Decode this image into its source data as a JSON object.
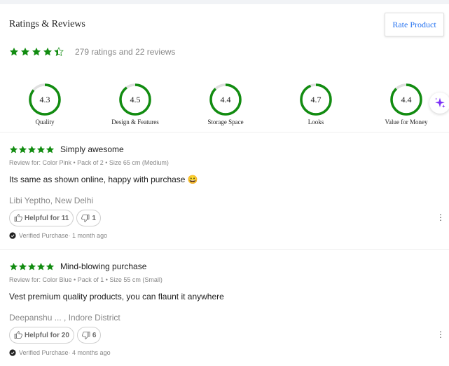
{
  "section": {
    "title": "Ratings & Reviews",
    "rate_button": "Rate Product",
    "overall_rating": 4.4,
    "overall_text": "279 ratings and 22 reviews"
  },
  "metrics": [
    {
      "value": "4.3",
      "label": "Quality",
      "fraction": 0.86
    },
    {
      "value": "4.5",
      "label": "Design & Features",
      "fraction": 0.9
    },
    {
      "value": "4.4",
      "label": "Storage Space",
      "fraction": 0.88
    },
    {
      "value": "4.7",
      "label": "Looks",
      "fraction": 0.94
    },
    {
      "value": "4.4",
      "label": "Value for Money",
      "fraction": 0.88
    }
  ],
  "reviews": [
    {
      "stars": 5,
      "title": "Simply awesome",
      "meta": "Review for: Color Pink • Pack of 2 • Size 65 cm (Medium)",
      "body": "Its same as shown online, happy with purchase 😀",
      "author": "Libi Yeptho, New Delhi",
      "helpful": "Helpful for 11",
      "unhelpful": "1",
      "verified": "Verified Purchase· 1 month ago"
    },
    {
      "stars": 5,
      "title": "Mind-blowing purchase",
      "meta": "Review for: Color Blue • Pack of 1 • Size 55 cm (Small)",
      "body": "Vest premium quality products, you can flaunt it anywhere",
      "author": "Deepanshu ... , Indore District",
      "helpful": "Helpful for 20",
      "unhelpful": "6",
      "verified": "Verified Purchase· 4 months ago"
    }
  ],
  "colors": {
    "accent_green": "#128c11",
    "ring_track": "#e0e0e0",
    "link_blue": "#2874f0",
    "sparkle_purple": "#7b2ff7"
  },
  "icons": {
    "star": "star-icon",
    "thumbs_up": "thumbs-up-icon",
    "thumbs_down": "thumbs-down-icon",
    "verified": "verified-check-icon",
    "more": "more-vertical-icon",
    "sparkle": "sparkle-icon"
  }
}
